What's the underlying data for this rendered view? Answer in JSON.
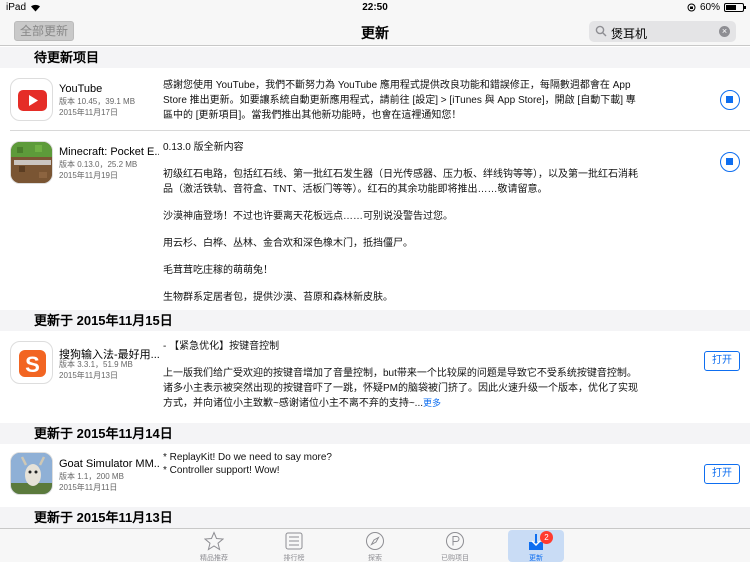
{
  "status": {
    "device": "iPad",
    "time": "22:50",
    "battery": "60%",
    "battery_level": 0.6
  },
  "nav": {
    "update_all": "全部更新",
    "title": "更新",
    "search_text": "煲耳机"
  },
  "sections": {
    "pending": "待更新项目",
    "nov15": "更新于 2015年11月15日",
    "nov14": "更新于 2015年11月14日",
    "nov13": "更新于 2015年11月13日"
  },
  "apps": {
    "youtube": {
      "name": "YouTube",
      "version": "版本 10.45，39.1 MB",
      "date": "2015年11月17日",
      "notes": "感謝您使用 YouTube，我們不斷努力為 YouTube 應用程式提供改良功能和錯誤修正，每隔數週都會在 App Store 推出更新。如要讓系統自動更新應用程式，請前往 [設定] > [iTunes 與 App Store]，開啟 [自動下載] 專區中的 [更新項目]。當我們推出其他新功能時，也會在這裡通知您！"
    },
    "minecraft": {
      "name": "Minecraft: Pocket E...",
      "version": "版本 0.13.0，25.2 MB",
      "date": "2015年11月19日",
      "notes": [
        "0.13.0 版全新内容",
        "初级红石电路，包括红石线、第一批红石发生器（日光传感器、压力板、绊线钩等等），以及第一批红石消耗品（激活铁轨、音符盒、TNT、活板门等等）。红石的其余功能即将推出……敬请留意。",
        "沙漠神庙登场！不过也许要离天花板远点……可别说没警告过您。",
        "用云杉、白桦、丛林、金合欢和深色橡木门，抵挡僵尸。",
        "毛茸茸吃庄稼的萌萌兔！",
        "生物群系定居者包，提供沙漠、苔原和森林新皮肤。"
      ]
    },
    "sogou": {
      "name": "搜狗输入法-最好用...",
      "version": "版本 3.3.1，51.9 MB",
      "date": "2015年11月13日",
      "notes": [
        "- 【紧急优化】按键音控制",
        "上一版我们给广受欢迎的按键音增加了音量控制，but带来一个比较屎的问题是导致它不受系统按键音控制。诸多小主表示被突然出现的按键音吓了一跳，怀疑PM的脑袋被门挤了。因此火速升级一个版本，优化了实现方式，并向诸位小主致歉~感谢诸位小主不离不弃的支持~..."
      ],
      "more": "更多",
      "button": "打开"
    },
    "goat": {
      "name": "Goat Simulator MM...",
      "version": "版本 1.1，200 MB",
      "date": "2015年11月11日",
      "notes": [
        "* ReplayKit! Do we need to say more?",
        "* Controller support! Wow!"
      ],
      "button": "打开"
    }
  },
  "tabs": [
    {
      "label": "精品推荐",
      "icon": "star-icon"
    },
    {
      "label": "排行榜",
      "icon": "list-icon"
    },
    {
      "label": "探索",
      "icon": "compass-icon"
    },
    {
      "label": "已购项目",
      "icon": "purchased-icon"
    },
    {
      "label": "更新",
      "icon": "download-icon",
      "badge": "2"
    }
  ],
  "colors": {
    "accent": "#0e6ef0",
    "badge": "#ff3b30"
  }
}
